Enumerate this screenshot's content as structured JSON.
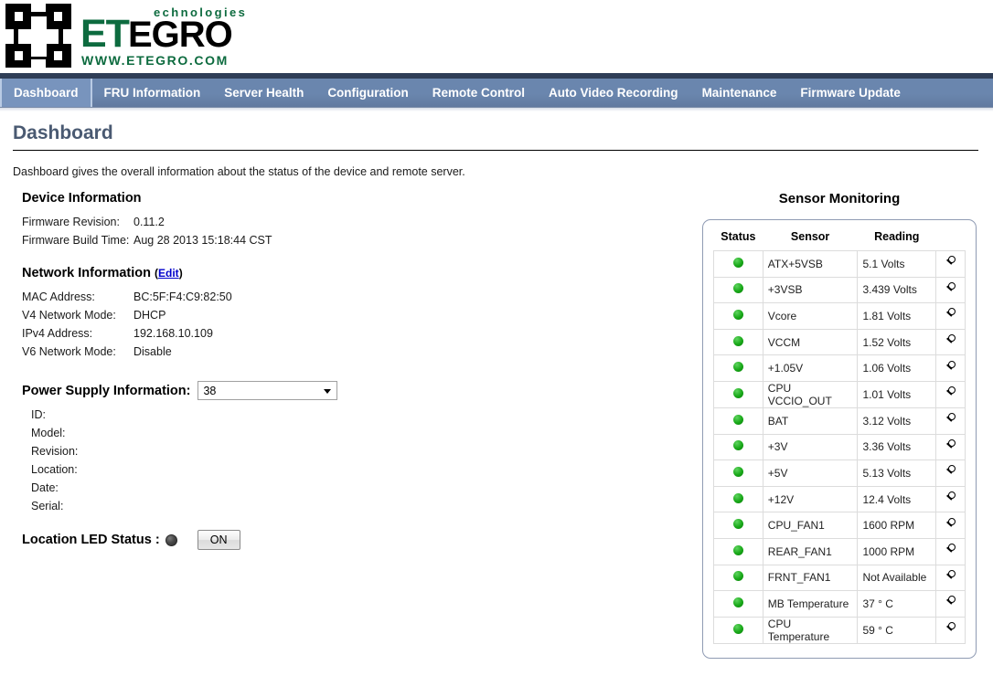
{
  "header": {
    "logo_tech": "echnologies",
    "logo_et": "ET",
    "logo_egro": "EGRO",
    "logo_www": "WWW.ETEGRO.COM",
    "logo_mark_name": "etegro-chip-logo"
  },
  "nav": {
    "items": [
      {
        "label": "Dashboard",
        "active": true
      },
      {
        "label": "FRU Information",
        "active": false
      },
      {
        "label": "Server Health",
        "active": false
      },
      {
        "label": "Configuration",
        "active": false
      },
      {
        "label": "Remote Control",
        "active": false
      },
      {
        "label": "Auto Video Recording",
        "active": false
      },
      {
        "label": "Maintenance",
        "active": false
      },
      {
        "label": "Firmware Update",
        "active": false
      }
    ]
  },
  "page": {
    "title": "Dashboard",
    "intro": "Dashboard gives the overall information about the status of the device and remote server."
  },
  "device_information": {
    "heading": "Device Information",
    "rows": [
      {
        "label": "Firmware Revision:",
        "value": "0.11.2"
      },
      {
        "label": "Firmware Build Time:",
        "value": "Aug 28 2013 15:18:44 CST"
      }
    ]
  },
  "network_information": {
    "heading": "Network Information",
    "edit_label": "Edit",
    "paren_open": "(",
    "paren_close": ")",
    "rows": [
      {
        "label": "MAC Address:",
        "value": "BC:5F:F4:C9:82:50"
      },
      {
        "label": "V4 Network Mode:",
        "value": "DHCP"
      },
      {
        "label": "IPv4 Address:",
        "value": "192.168.10.109"
      },
      {
        "label": "V6 Network Mode:",
        "value": "Disable"
      }
    ]
  },
  "power_supply": {
    "heading": "Power Supply Information:",
    "selected": "38",
    "options": [
      "38"
    ],
    "fields": [
      {
        "label": "ID:",
        "value": ""
      },
      {
        "label": "Model:",
        "value": ""
      },
      {
        "label": "Revision:",
        "value": ""
      },
      {
        "label": "Location:",
        "value": ""
      },
      {
        "label": "Date:",
        "value": ""
      },
      {
        "label": "Serial:",
        "value": ""
      }
    ]
  },
  "location_led": {
    "label": "Location LED Status :",
    "state_color": "#3f3f3f",
    "button_label": "ON"
  },
  "sensor_monitoring": {
    "title": "Sensor Monitoring",
    "columns": [
      "Status",
      "Sensor",
      "Reading"
    ],
    "status_color": "#18a818",
    "action_icon": "magnifier-icon",
    "rows": [
      {
        "status": "ok",
        "sensor": "ATX+5VSB",
        "reading": "5.1 Volts"
      },
      {
        "status": "ok",
        "sensor": "+3VSB",
        "reading": "3.439 Volts"
      },
      {
        "status": "ok",
        "sensor": "Vcore",
        "reading": "1.81 Volts"
      },
      {
        "status": "ok",
        "sensor": "VCCM",
        "reading": "1.52 Volts"
      },
      {
        "status": "ok",
        "sensor": "+1.05V",
        "reading": "1.06 Volts"
      },
      {
        "status": "ok",
        "sensor": "CPU VCCIO_OUT",
        "reading": "1.01 Volts"
      },
      {
        "status": "ok",
        "sensor": "BAT",
        "reading": "3.12 Volts"
      },
      {
        "status": "ok",
        "sensor": "+3V",
        "reading": "3.36 Volts"
      },
      {
        "status": "ok",
        "sensor": "+5V",
        "reading": "5.13 Volts"
      },
      {
        "status": "ok",
        "sensor": "+12V",
        "reading": "12.4 Volts"
      },
      {
        "status": "ok",
        "sensor": "CPU_FAN1",
        "reading": "1600 RPM"
      },
      {
        "status": "ok",
        "sensor": "REAR_FAN1",
        "reading": "1000 RPM"
      },
      {
        "status": "ok",
        "sensor": "FRNT_FAN1",
        "reading": "Not Available"
      },
      {
        "status": "ok",
        "sensor": "MB Temperature",
        "reading": "37 ° C"
      },
      {
        "status": "ok",
        "sensor": "CPU Temperature",
        "reading": "59 ° C"
      }
    ]
  },
  "theme": {
    "nav_blue": "#6a86ae",
    "nav_active": "#7894bd",
    "nav_dark_strip": "#2f3e57",
    "title_color": "#4a5a72",
    "brand_green": "#0d6b3f",
    "link_blue": "#0000cc",
    "panel_border": "#8f9bb3"
  }
}
